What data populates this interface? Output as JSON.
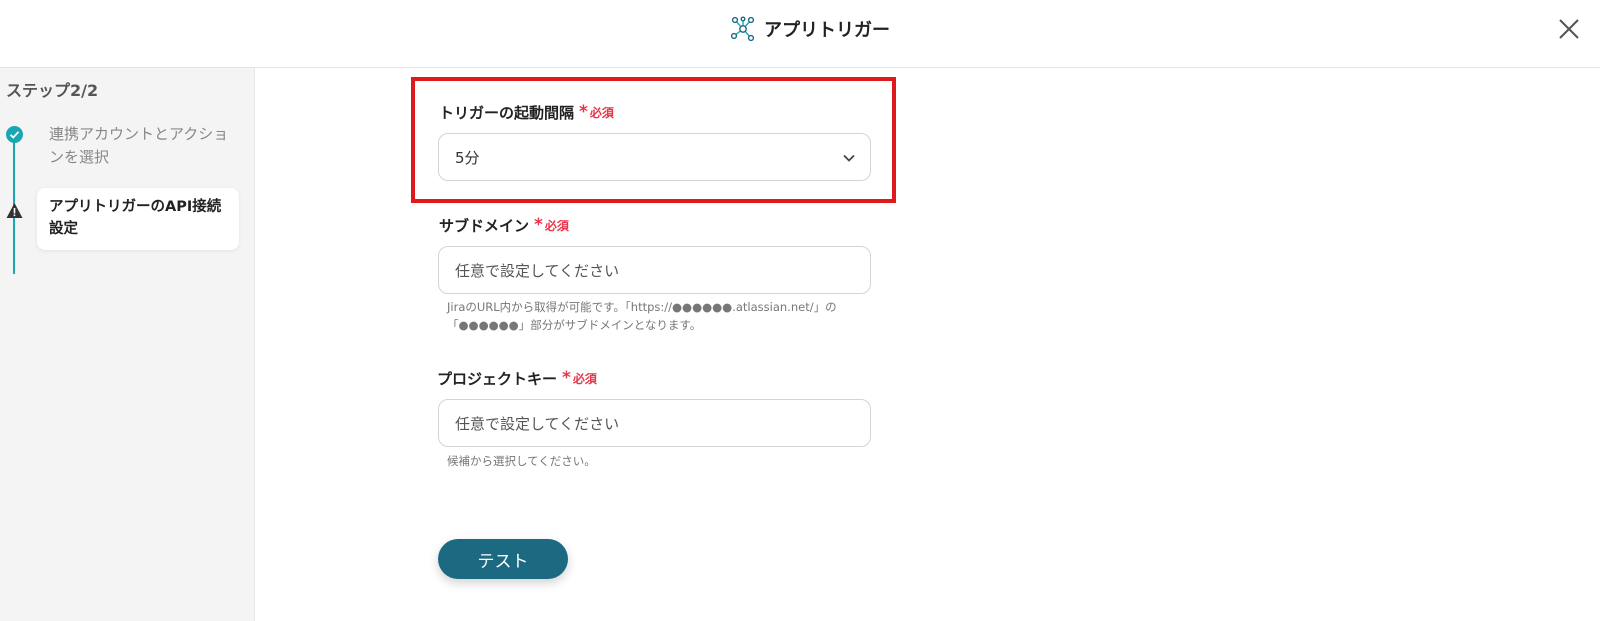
{
  "header": {
    "title": "アプリトリガー",
    "logo_icon": "network-nodes-icon",
    "close_icon": "close-icon"
  },
  "sidebar": {
    "step_counter": "ステップ2/2",
    "steps": [
      {
        "label": "連携アカウントとアクションを選択",
        "status": "completed",
        "icon": "check-circle-icon"
      },
      {
        "label": "アプリトリガーのAPI接続設定",
        "status": "current-warning",
        "icon": "warning-icon"
      }
    ]
  },
  "form": {
    "required_label": "必須",
    "trigger_interval": {
      "label": "トリガーの起動間隔",
      "value": "5分"
    },
    "subdomain": {
      "label": "サブドメイン",
      "placeholder": "任意で設定してください",
      "hint_line1": "JiraのURL内から取得が可能です。「https://●●●●●●.atlassian.net/」の",
      "hint_line2": "「●●●●●●」部分がサブドメインとなります。"
    },
    "project_key": {
      "label": "プロジェクトキー",
      "placeholder": "任意で設定してください",
      "hint": "候補から選択してください。"
    },
    "test_button": "テスト"
  },
  "colors": {
    "accent": "#1aa7b4",
    "button": "#1b6a82",
    "required": "#e8354a",
    "highlight": "#e01a1a"
  }
}
